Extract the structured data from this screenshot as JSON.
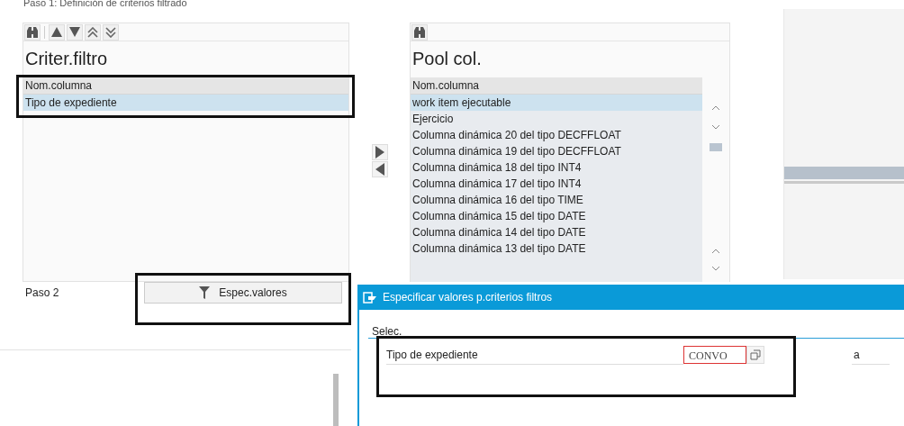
{
  "step1_label": "Paso 1: Definición de criterios filtrado",
  "criteria_panel": {
    "title": "Criter.filtro",
    "column_header": "Nom.columna",
    "rows": [
      {
        "label": "Tipo de expediente",
        "selected": true
      }
    ]
  },
  "pool_panel": {
    "title": "Pool col.",
    "column_header": "Nom.columna",
    "rows": [
      {
        "label": "work item ejecutable",
        "selected": true
      },
      {
        "label": "Ejercicio",
        "selected": false
      },
      {
        "label": "Columna dinámica 20 del tipo DECFFLOAT",
        "selected": false
      },
      {
        "label": "Columna dinámica 19 del tipo DECFFLOAT",
        "selected": false
      },
      {
        "label": "Columna dinámica 18 del tipo INT4",
        "selected": false
      },
      {
        "label": "Columna dinámica 17 del tipo INT4",
        "selected": false
      },
      {
        "label": "Columna dinámica 16 del tipo TIME",
        "selected": false
      },
      {
        "label": "Columna dinámica 15 del tipo DATE",
        "selected": false
      },
      {
        "label": "Columna dinámica 14 del tipo DATE",
        "selected": false
      },
      {
        "label": "Columna dinámica 13 del tipo DATE",
        "selected": false
      }
    ]
  },
  "step2_label": "Paso 2",
  "spec_button": "Espec.valores",
  "dialog": {
    "title": "Especificar valores p.criterios filtros",
    "tab": "Selec.",
    "field_label": "Tipo de expediente",
    "field_value": "CONVO",
    "to_label": "a"
  }
}
